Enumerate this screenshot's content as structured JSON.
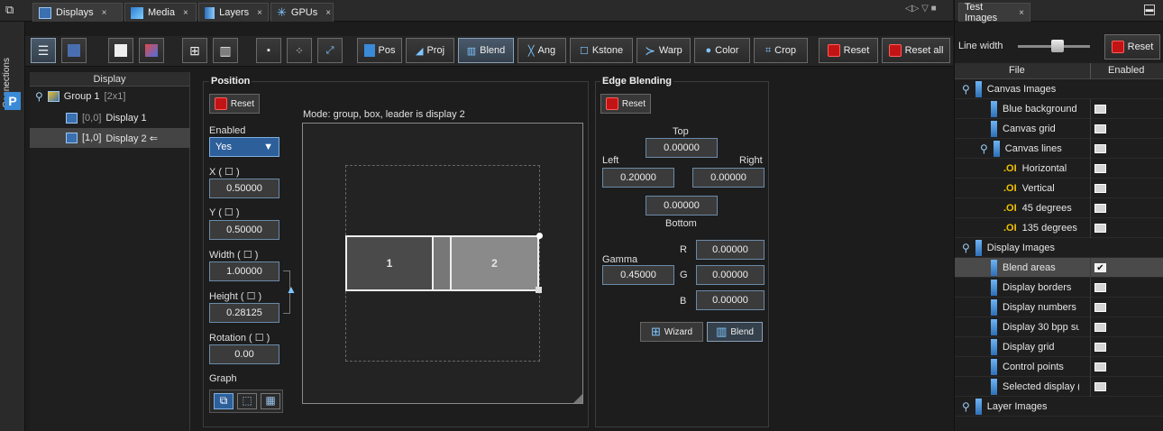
{
  "tabs": [
    {
      "label": "Displays",
      "close": "×"
    },
    {
      "label": "Media",
      "close": "×"
    },
    {
      "label": "Layers",
      "close": "×"
    },
    {
      "label": "GPUs",
      "close": "×"
    }
  ],
  "sidebar": {
    "connections_label": "Connections",
    "badge": "P"
  },
  "toolbar": {
    "pos": "Pos",
    "proj": "Proj",
    "blend": "Blend",
    "ang": "Ang",
    "kstone": "Kstone",
    "warp": "Warp",
    "color": "Color",
    "crop": "Crop",
    "reset": "Reset",
    "reset_all": "Reset all"
  },
  "tree": {
    "header": "Display",
    "group": {
      "label": "Group 1",
      "size": "[2x1]"
    },
    "items": [
      {
        "coord": "[0,0]",
        "label": "Display 1"
      },
      {
        "coord": "[1,0]",
        "label": "Display 2 ⇐"
      }
    ]
  },
  "position": {
    "title": "Position",
    "reset": "Reset",
    "mode": "Mode: group, box, leader is display 2",
    "enabled_label": "Enabled",
    "enabled_value": "Yes",
    "x_label": "X ( ☐ )",
    "x_value": "0.50000",
    "y_label": "Y ( ☐ )",
    "y_value": "0.50000",
    "width_label": "Width ( ☐ )",
    "width_value": "1.00000",
    "height_label": "Height ( ☐ )",
    "height_value": "0.28125",
    "rotation_label": "Rotation ( ☐ )",
    "rotation_value": "0.00",
    "graph_label": "Graph",
    "display1": "1",
    "display2": "2"
  },
  "edge": {
    "title": "Edge Blending",
    "reset": "Reset",
    "top_label": "Top",
    "top": "0.00000",
    "left_label": "Left",
    "left": "0.20000",
    "right_label": "Right",
    "right": "0.00000",
    "bottom_label": "Bottom",
    "bottom": "0.00000",
    "gamma_label": "Gamma",
    "gamma": "0.45000",
    "r_label": "R",
    "r": "0.00000",
    "g_label": "G",
    "g": "0.00000",
    "b_label": "B",
    "b": "0.00000",
    "wizard": "Wizard",
    "blend": "Blend"
  },
  "test_images": {
    "tab": "Test Images",
    "close": "×",
    "line_width_label": "Line width",
    "line_width_level": 0.55,
    "reset": "Reset",
    "col_file": "File",
    "col_enabled": "Enabled",
    "rows": [
      {
        "label": "Canvas Images",
        "kind": "group"
      },
      {
        "label": "Blue background",
        "kind": "item",
        "enabled": false
      },
      {
        "label": "Canvas grid",
        "kind": "item",
        "enabled": false
      },
      {
        "label": "Canvas lines",
        "kind": "subgroup",
        "enabled": false
      },
      {
        "label": "Horizontal",
        "kind": "ol",
        "enabled": false
      },
      {
        "label": "Vertical",
        "kind": "ol",
        "enabled": false
      },
      {
        "label": "45 degrees",
        "kind": "ol",
        "enabled": false
      },
      {
        "label": "135 degrees",
        "kind": "ol",
        "enabled": false
      },
      {
        "label": "Display Images",
        "kind": "group"
      },
      {
        "label": "Blend areas",
        "kind": "item",
        "enabled": true
      },
      {
        "label": "Display borders",
        "kind": "item",
        "enabled": false
      },
      {
        "label": "Display numbers",
        "kind": "item",
        "enabled": false
      },
      {
        "label": "Display 30 bpp su",
        "kind": "item",
        "enabled": false
      },
      {
        "label": "Display grid",
        "kind": "item",
        "enabled": false
      },
      {
        "label": "Control points",
        "kind": "item",
        "enabled": false
      },
      {
        "label": "Selected display (",
        "kind": "item",
        "enabled": false
      },
      {
        "label": "Layer Images",
        "kind": "group"
      }
    ]
  },
  "colors": {
    "accent": "#3a8ad8",
    "reset_red": "#c21414",
    "selected": "#444444"
  }
}
